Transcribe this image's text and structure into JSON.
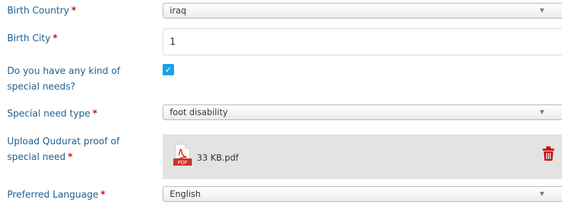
{
  "form": {
    "birth_country": {
      "label": "Birth Country",
      "required": "*",
      "value": "iraq"
    },
    "birth_city": {
      "label": "Birth City",
      "required": "*",
      "value": "1"
    },
    "special_needs": {
      "label_line1": "Do you have any kind of",
      "label_line2": "special needs?",
      "checked": true,
      "check_glyph": "✓"
    },
    "special_need_type": {
      "label": "Special need type",
      "required": "*",
      "value": "foot disability"
    },
    "upload_proof": {
      "label_line1": "Upload Qudurat proof of",
      "label_line2": "special need",
      "required": "*",
      "file_badge": "PDF",
      "file_name": "33 KB.pdf",
      "file_icon": "pdf-file-icon",
      "delete_icon": "trash-icon"
    },
    "preferred_language": {
      "label": "Preferred Language",
      "required": "*",
      "value": "English"
    },
    "select_arrow": "▼"
  },
  "colors": {
    "label": "#1f5f8f",
    "required": "#c8102e",
    "checkbox": "#1aa0e8",
    "upload_bg": "#e3e3e3",
    "pdf_red": "#d0312d"
  }
}
